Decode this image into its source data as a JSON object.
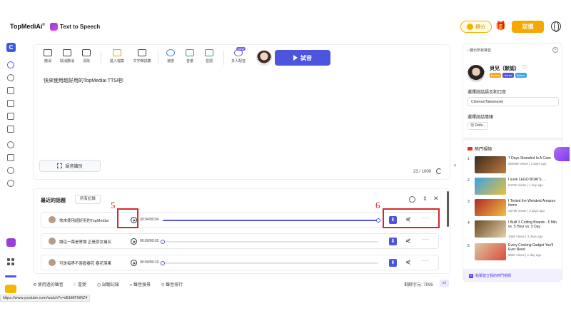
{
  "header": {
    "brand": "TopMediAi",
    "brand_sup": "®",
    "title": "Text to Speech",
    "coin_label": "積分",
    "buy_label": "定價"
  },
  "toolbar": [
    {
      "label": "撤消",
      "icon": "undo-icon"
    },
    {
      "label": "取消撤消",
      "icon": "redo-icon"
    },
    {
      "label": "清除",
      "icon": "clear-icon"
    },
    {
      "label": "匯入檔案",
      "icon": "folder-icon"
    },
    {
      "label": "文字轉試聽",
      "icon": "convert-icon"
    },
    {
      "label": "速度",
      "icon": "speed-icon"
    },
    {
      "label": "音量",
      "icon": "volume-icon"
    },
    {
      "label": "音調",
      "icon": "pitch-icon"
    },
    {
      "label": "多人配音",
      "icon": "multi-voice-icon"
    }
  ],
  "new_tag": "NEW",
  "play_label": "試音",
  "editor": {
    "text": "快來使用超好用的TopMediai TTS吧!",
    "subtitle_btn": "語音識別",
    "char_count": "23 / 1000"
  },
  "history": {
    "title": "最近的話題",
    "tab": "所有記錄",
    "rows": [
      {
        "text": "快來使用超好用的TopMediai",
        "time": "00:04/00:04",
        "progress": 1.0
      },
      {
        "text": "讓這一幕是寄讓 正是原女補名",
        "time": "00:00/00:02",
        "progress": 0.0
      },
      {
        "text": "可是每界不喜歡春花 春花落果",
        "time": "00:00/00:10",
        "progress": 0.0
      }
    ],
    "annotation_left": "5",
    "annotation_right": "6"
  },
  "bottom": {
    "items": [
      "使用過的聲音",
      "喜愛",
      "試聽記錄",
      "聲音搜尋",
      "聲音排行"
    ],
    "remaining": "剩餘字元: 7095",
    "chip": "x1"
  },
  "status_url": "https://www.youtube.com/watch?v=dEbMF9iRZ4",
  "right": {
    "back": "顯示所有聲音",
    "voice_name": "貝兒（默認）",
    "tags": [
      {
        "label": "Beauty",
        "color": "#f5a623"
      },
      {
        "label": "Adults",
        "color": "#4b55dd"
      },
      {
        "label": "Nature",
        "color": "#3da5f4"
      }
    ],
    "lang_label": "選擇說話語言和口音",
    "lang_value": "Chinese(Taiwanese)",
    "emotion_label": "選擇說話情緒",
    "emotion_value": "Defa...",
    "hot_label": "熱門視頻",
    "videos": [
      {
        "num": "1",
        "title": "7 Days Stranded In A Cave",
        "meta": "55963k Views | 3 days ago"
      },
      {
        "num": "2",
        "title": "I sunk LEGO BOATS ...",
        "meta": "6476k Views | 1 day ago"
      },
      {
        "num": "3",
        "title": "I Tested the Weirdest Amazon Items",
        "meta": "3379k Views | 3 days ago"
      },
      {
        "num": "4",
        "title": "I Built 3 Cutting Boards - 5 Min vs. 5 Hour vs. 5 Day",
        "meta": "345k Views | 3 days ago"
      },
      {
        "num": "5",
        "title": "Every Cooking Gadget You'll Ever Need",
        "meta": "555k Views | 1 day ago"
      }
    ],
    "footer": "點擊建立我的熱門視頻"
  },
  "colors": {
    "accent": "#4b55dd",
    "annotation": "#d6282c",
    "gold": "#f5a800"
  }
}
